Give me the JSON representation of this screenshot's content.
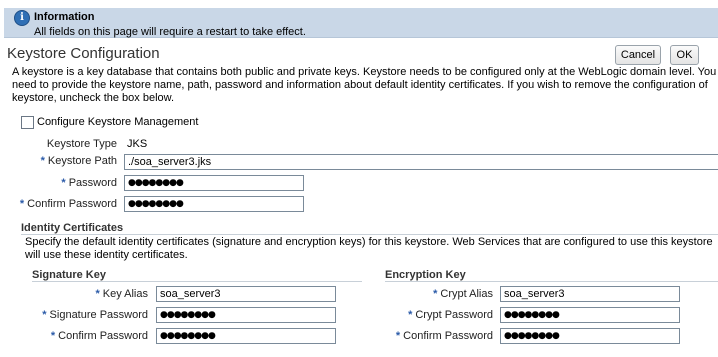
{
  "info": {
    "icon": "info-icon",
    "title": "Information",
    "text": "All fields on this page will require a restart to take effect."
  },
  "page": {
    "title": "Keystore Configuration",
    "cancel_label": "Cancel",
    "ok_label": "OK",
    "description": [
      "A keystore is a key database that contains both public and private keys. Keystore needs to be configured only at the WebLogic domain level. You",
      "need to provide the keystore name, path, password and information about default identity certificates. If you wish to remove the configuration of",
      "keystore, uncheck the box below."
    ]
  },
  "config": {
    "checkbox_label": "Configure Keystore Management",
    "checked": false
  },
  "keystore": {
    "type_label": "Keystore Type",
    "type_value": "JKS",
    "path_label": "Keystore Path",
    "path_value": "./soa_server3.jks",
    "password_label": "Password",
    "password_value": "●●●●●●●●",
    "confirm_label": "Confirm Password",
    "confirm_value": "●●●●●●●●",
    "required_mark": "*"
  },
  "identity": {
    "title": "Identity Certificates",
    "description": [
      "Specify the default identity certificates (signature and encryption keys) for this keystore. Web Services that are configured to use this keystore",
      "will use these identity certificates."
    ]
  },
  "signature": {
    "title": "Signature Key",
    "alias_label": "Key Alias",
    "alias_value": "soa_server3",
    "password_label": "Signature Password",
    "password_value": "●●●●●●●●",
    "confirm_label": "Confirm Password",
    "confirm_value": "●●●●●●●●"
  },
  "encryption": {
    "title": "Encryption Key",
    "alias_label": "Crypt Alias",
    "alias_value": "soa_server3",
    "password_label": "Crypt Password",
    "password_value": "●●●●●●●●",
    "confirm_label": "Confirm Password",
    "confirm_value": "●●●●●●●●"
  }
}
